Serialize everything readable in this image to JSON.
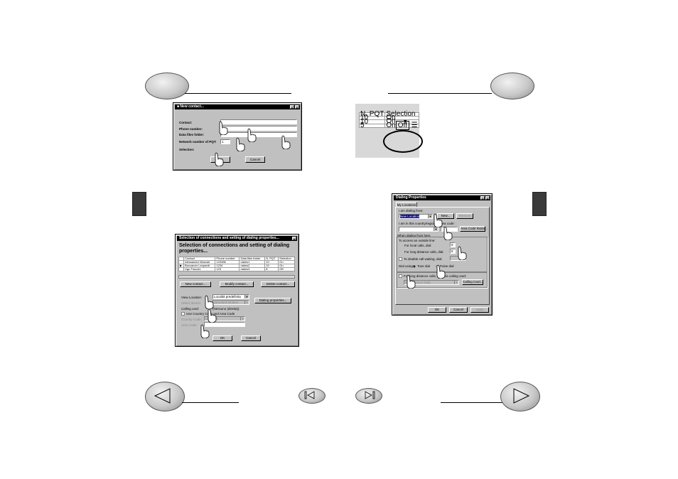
{
  "dlg_new_contact": {
    "title": "New contact...",
    "help": "?",
    "close": "X",
    "labels": [
      "Contact:",
      "Phone number:",
      "Data files folder:",
      "Network number of PQT:",
      "Selection:"
    ],
    "pqt_value": "1",
    "ok": "OK",
    "cancel": "Cancel"
  },
  "grid_zoom": {
    "headers": [
      "N. PQT",
      "Selection"
    ],
    "rows": [
      {
        "pqt": "10",
        "sel": "On"
      },
      {
        "pqt": "10",
        "sel": "On"
      },
      {
        "pqt": "5",
        "sel": "Off"
      }
    ],
    "edit_prefix": "On"
  },
  "dlg_selection": {
    "title": "Selection of connections and setting of dialing properties...",
    "heading": "Selection of connections and setting of dialing properties...",
    "columns": [
      "Contact",
      "Phone number",
      "Data files folder",
      "N. PQT",
      "Selection"
    ],
    "rows": [
      [
        "Alessandro Mazzari",
        "123456",
        "nakes1",
        "10",
        "On"
      ],
      [
        "Boccaccio Leopardi",
        "1234",
        "nakes2",
        "10",
        "On"
      ],
      [
        "Ugo Foscolo",
        "123",
        "nakes3",
        "8",
        "Off"
      ]
    ],
    "btn_new": "New contact...",
    "btn_modify": "Modify contact...",
    "btn_delete": "Delete contact...",
    "lbl_view_location": "View Location:",
    "view_location_value": "Località predefinita",
    "lbl_select_device": "Select device:",
    "device_value": "Standard Modem",
    "calling_card_lbl": "Calling card:",
    "calling_card_value": "(Nessuno (diretta))",
    "use_country": "Use Country Code and Area Code",
    "lbl_country_code": "Country Code:",
    "country_code_value": "Italy (39)",
    "lbl_area_code": "Area Code:",
    "btn_dialing": "Dialing properties...",
    "ok": "OK",
    "cancel": "Cancel"
  },
  "dlg_dialing": {
    "title": "Dialing Properties",
    "tab": "My Locations",
    "dialing_from_lbl": "I am dialing from:",
    "dialing_from_value": "New Location",
    "btn_new": "New...",
    "btn_remove": "Remove",
    "country_lbl": "I am in this country/region:",
    "area_lbl": "Area code:",
    "btn_area_rules": "Area Code Rules...",
    "when_dialing": "When dialing from here",
    "outside_line": "To access an outside line:",
    "local_calls": "For local calls, dial:",
    "local_value": "9",
    "long_calls": "For long distance calls, dial:",
    "long_value": "8",
    "disable_waiting": "To disable call waiting, dial:",
    "dial_using": "Dial using:",
    "tone": "Tone dial",
    "pulse": "Pulse dial",
    "calling_card_chk": "For long distance calls, use this calling card:",
    "calling_card_value": "None (Direct Dial)",
    "btn_calling_card": "Calling Card...",
    "ok": "OK",
    "cancel": "Cancel",
    "apply": "Apply"
  }
}
